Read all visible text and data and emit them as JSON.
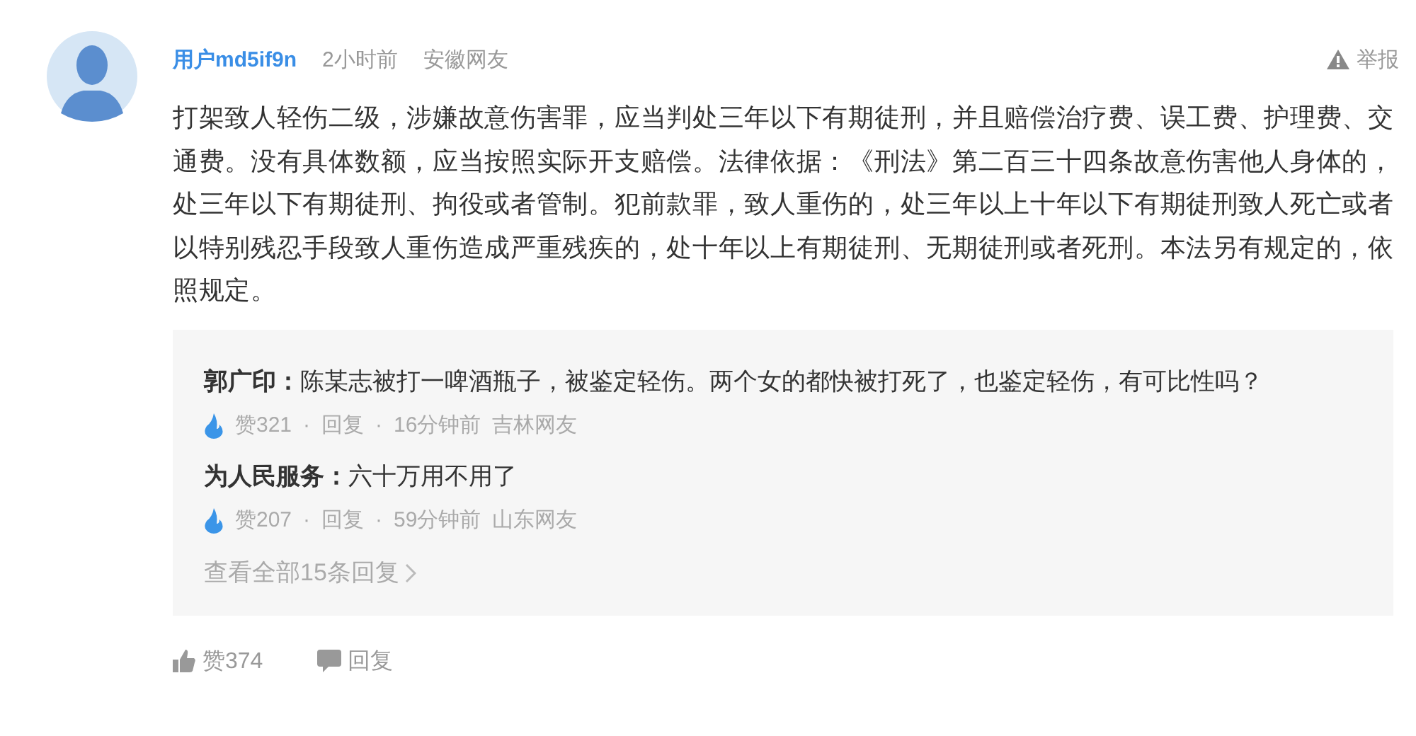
{
  "comment": {
    "username": "用户md5if9n",
    "time": "2小时前",
    "location": "安徽网友",
    "report": "举报",
    "body": "打架致人轻伤二级，涉嫌故意伤害罪，应当判处三年以下有期徒刑，并且赔偿治疗费、误工费、护理费、交通费。没有具体数额，应当按照实际开支赔偿。法律依据：《刑法》第二百三十四条故意伤害他人身体的，处三年以下有期徒刑、拘役或者管制。犯前款罪，致人重伤的，处三年以上十年以下有期徒刑致人死亡或者以特别残忍手段致人重伤造成严重残疾的，处十年以上有期徒刑、无期徒刑或者死刑。本法另有规定的，依照规定。",
    "replies": [
      {
        "author": "郭广印：",
        "separator": "·",
        "text": "陈某志被打一啤酒瓶子，被鉴定轻伤。两个女的都快被打死了，也鉴定轻伤，有可比性吗？",
        "likes": "赞321",
        "reply": "回复",
        "time": "16分钟前",
        "location": "吉林网友"
      },
      {
        "author": "为人民服务：",
        "separator": "·",
        "text": "六十万用不用了",
        "likes": "赞207",
        "reply": "回复",
        "time": "59分钟前",
        "location": "山东网友"
      }
    ],
    "view_all": "查看全部15条回复",
    "likes": "赞374",
    "reply": "回复"
  }
}
